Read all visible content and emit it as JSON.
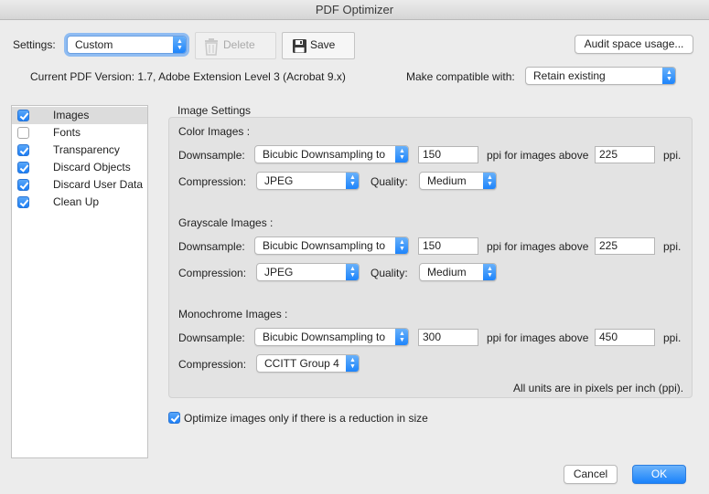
{
  "window": {
    "title": "PDF Optimizer"
  },
  "header": {
    "settings_label": "Settings:",
    "settings_value": "Custom",
    "delete_label": "Delete",
    "save_label": "Save",
    "audit_label": "Audit space usage...",
    "version_text": "Current PDF Version: 1.7, Adobe Extension Level 3 (Acrobat 9.x)",
    "compat_label": "Make compatible with:",
    "compat_value": "Retain existing"
  },
  "sidebar": {
    "items": [
      {
        "label": "Images",
        "checked": true,
        "selected": true
      },
      {
        "label": "Fonts",
        "checked": false,
        "selected": false
      },
      {
        "label": "Transparency",
        "checked": true,
        "selected": false
      },
      {
        "label": "Discard Objects",
        "checked": true,
        "selected": false
      },
      {
        "label": "Discard User Data",
        "checked": true,
        "selected": false
      },
      {
        "label": "Clean Up",
        "checked": true,
        "selected": false
      }
    ]
  },
  "image_settings": {
    "group_title": "Image Settings",
    "downsample_label": "Downsample:",
    "compression_label": "Compression:",
    "quality_label": "Quality:",
    "ppi_above_label": "ppi for images above",
    "ppi_label": "ppi.",
    "color": {
      "title": "Color Images :",
      "downsample": "Bicubic Downsampling to",
      "ppi": "150",
      "above": "225",
      "compression": "JPEG",
      "quality": "Medium"
    },
    "grayscale": {
      "title": "Grayscale Images :",
      "downsample": "Bicubic Downsampling to",
      "ppi": "150",
      "above": "225",
      "compression": "JPEG",
      "quality": "Medium"
    },
    "monochrome": {
      "title": "Monochrome Images :",
      "downsample": "Bicubic Downsampling to",
      "ppi": "300",
      "above": "450",
      "compression": "CCITT Group 4"
    },
    "units_note": "All units are in pixels per inch (ppi)."
  },
  "optimize_only": {
    "label": "Optimize images only if there is a reduction in size",
    "checked": true
  },
  "footer": {
    "cancel_label": "Cancel",
    "ok_label": "OK"
  },
  "colors": {
    "accent": "#1a82fb",
    "selection": "#dcdcdc",
    "panel": "#e3e3e3"
  }
}
